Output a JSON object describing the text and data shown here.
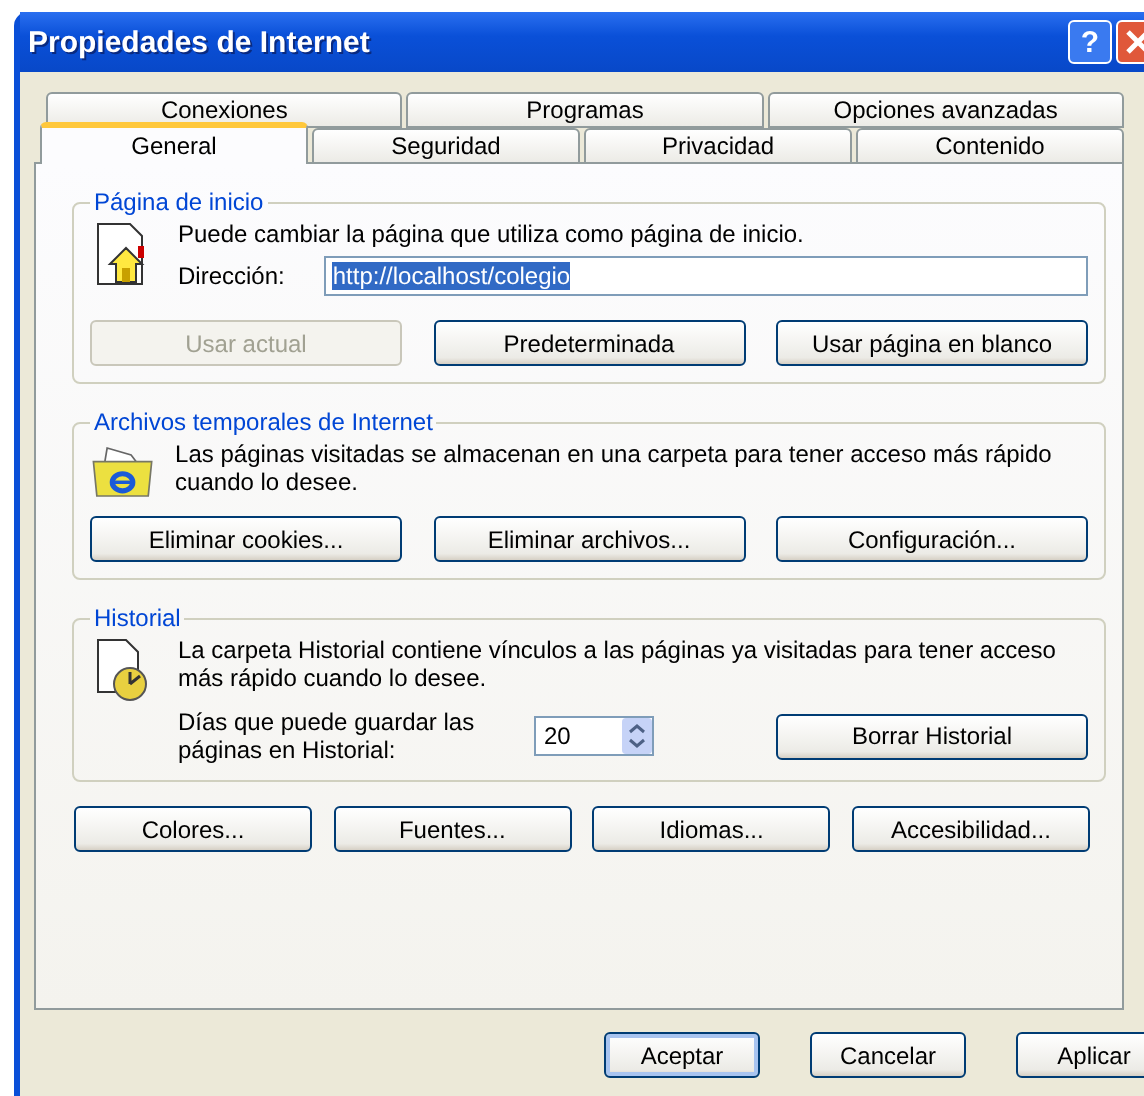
{
  "window": {
    "title": "Propiedades de Internet",
    "help_button": "?"
  },
  "tab_rows": [
    [
      {
        "label": "Conexiones",
        "selected": false
      },
      {
        "label": "Programas",
        "selected": false
      },
      {
        "label": "Opciones avanzadas",
        "selected": false
      }
    ],
    [
      {
        "label": "General",
        "selected": true
      },
      {
        "label": "Seguridad",
        "selected": false
      },
      {
        "label": "Privacidad",
        "selected": false
      },
      {
        "label": "Contenido",
        "selected": false
      }
    ]
  ],
  "home_page": {
    "title": "Página de inicio",
    "description": "Puede cambiar la página que utiliza como página de inicio.",
    "address_label": "Dirección:",
    "address_value": "http://localhost/colegio",
    "address_highlighted": true,
    "buttons": [
      {
        "label": "Usar actual",
        "disabled": true
      },
      {
        "label": "Predeterminada",
        "disabled": false
      },
      {
        "label": "Usar página en blanco",
        "disabled": false
      }
    ]
  },
  "temp_files": {
    "title": "Archivos temporales de Internet",
    "description": "Las páginas visitadas se almacenan en una carpeta para tener acceso más rápido cuando lo desee.",
    "buttons": [
      {
        "label": "Eliminar cookies...",
        "disabled": false
      },
      {
        "label": "Eliminar archivos...",
        "disabled": false
      },
      {
        "label": "Configuración...",
        "disabled": false
      }
    ]
  },
  "history": {
    "title": "Historial",
    "description": "La carpeta Historial contiene vínculos a las páginas ya visitadas para tener acceso más rápido cuando lo desee.",
    "days_label": "Días que puede guardar las páginas en Historial:",
    "days_value": "20",
    "buttons": [
      {
        "label": "Borrar Historial",
        "disabled": false
      }
    ]
  },
  "bottom_buttons": [
    {
      "label": "Colores..."
    },
    {
      "label": "Fuentes..."
    },
    {
      "label": "Idiomas..."
    },
    {
      "label": "Accesibilidad..."
    }
  ],
  "dialog_buttons": [
    {
      "label": "Aceptar",
      "default": true
    },
    {
      "label": "Cancelar",
      "default": false
    },
    {
      "label": "Aplicar",
      "default": false
    }
  ]
}
